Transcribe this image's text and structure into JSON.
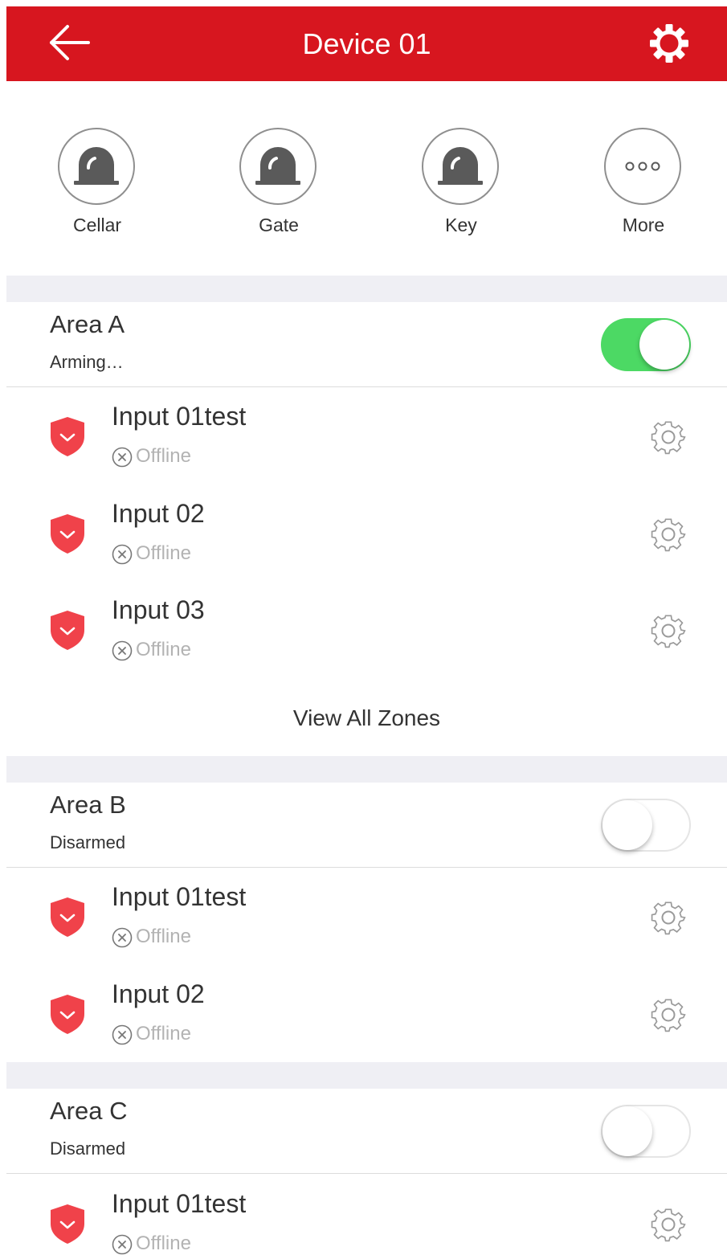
{
  "header": {
    "title": "Device 01",
    "back_icon": "arrow-left-icon",
    "settings_icon": "gear-icon",
    "background_color": "#d7161f"
  },
  "shortcuts": [
    {
      "label": "Cellar",
      "icon": "siren-icon"
    },
    {
      "label": "Gate",
      "icon": "siren-icon"
    },
    {
      "label": "Key",
      "icon": "siren-icon"
    },
    {
      "label": "More",
      "icon": "more-dots-icon"
    }
  ],
  "areas": [
    {
      "name": "Area A",
      "status": "Arming…",
      "armed": true,
      "zones": [
        {
          "name": "Input 01test",
          "status": "Offline"
        },
        {
          "name": "Input 02",
          "status": "Offline"
        },
        {
          "name": "Input 03",
          "status": "Offline"
        }
      ],
      "view_all_label": "View All Zones"
    },
    {
      "name": "Area B",
      "status": "Disarmed",
      "armed": false,
      "zones": [
        {
          "name": "Input 01test",
          "status": "Offline"
        },
        {
          "name": "Input 02",
          "status": "Offline"
        }
      ]
    },
    {
      "name": "Area C",
      "status": "Disarmed",
      "armed": false,
      "zones": [
        {
          "name": "Input 01test",
          "status": "Offline"
        }
      ]
    }
  ],
  "colors": {
    "accent": "#d7161f",
    "shield": "#f0424a",
    "toggle_on": "#4cd964",
    "offline_text": "#b3b3b3",
    "section_gap": "#efeff4"
  }
}
